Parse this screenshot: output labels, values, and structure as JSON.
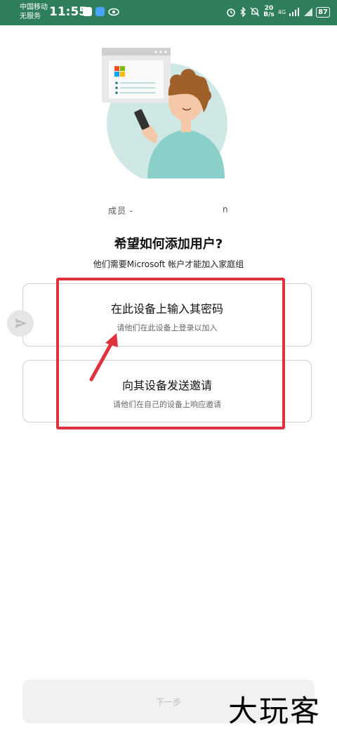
{
  "status_bar": {
    "carrier_line1": "中国移动",
    "carrier_line2": "无服务",
    "time": "11:55",
    "net_speed_value": "20",
    "net_speed_unit": "B/s",
    "signal_tag": "4G",
    "battery": "87",
    "icons": [
      "message-icon",
      "weather-icon",
      "eye-icon",
      "alarm-icon",
      "bluetooth-icon",
      "mute-icon",
      "signal-icon",
      "battery-icon"
    ]
  },
  "illustration": {
    "icon": "user-with-phone-illustration",
    "accent": "#cfe8e6"
  },
  "member": {
    "label": "成员 -",
    "masked_tail": "n"
  },
  "heading": "希望如何添加用户?",
  "subheading": "他们需要Microsoft 帐户才能加入家庭组",
  "options": [
    {
      "title": "在此设备上输入其密码",
      "description": "请他们在此设备上登录以加入"
    },
    {
      "title": "向其设备发送邀请",
      "description": "请他们在自己的设备上响应邀请"
    }
  ],
  "next_button": {
    "label": "下一步"
  },
  "watermark": "大玩客",
  "colors": {
    "status_bar": "#2e7d5b",
    "highlight": "#e0313f",
    "button_bg": "#f1f1f1"
  }
}
